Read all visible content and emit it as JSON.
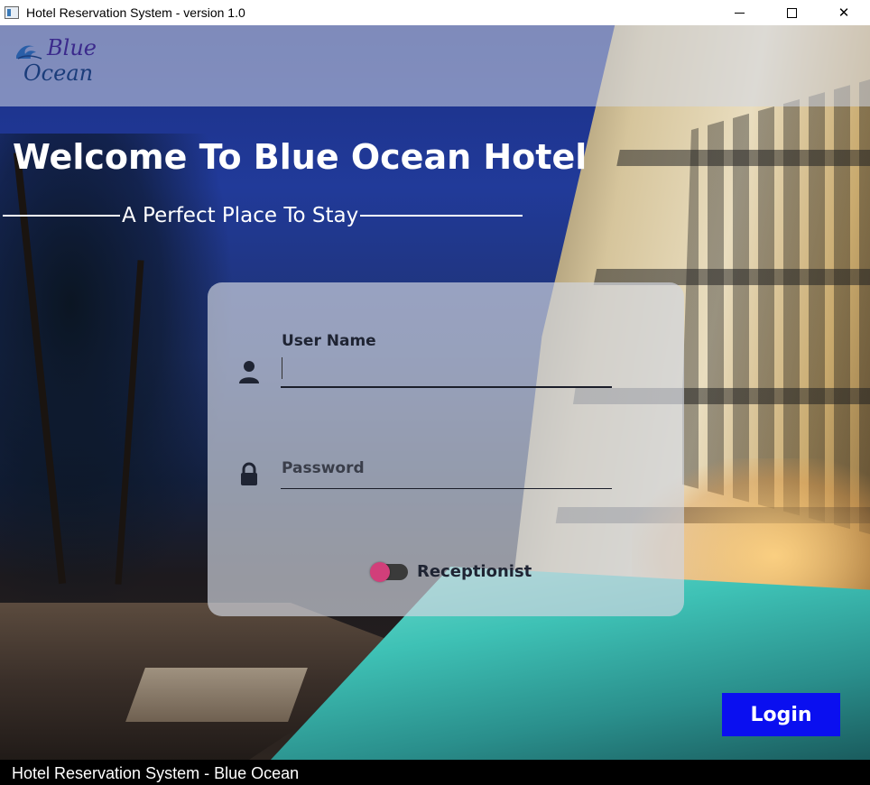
{
  "window": {
    "title": "Hotel Reservation System - version 1.0",
    "controls": [
      "minimize-icon",
      "maximize-icon",
      "close-icon"
    ],
    "close_glyph": "✕"
  },
  "logo": {
    "line1": "Blue",
    "line2": "Ocean"
  },
  "hero": {
    "title": "Welcome To Blue Ocean Hotel",
    "tagline": "A Perfect Place To Stay"
  },
  "login_form": {
    "username_label": "User Name",
    "username_value": "",
    "password_label": "Password",
    "password_value": "",
    "role_toggle_label": "Receptionist",
    "role_toggle_on": false,
    "submit_label": "Login"
  },
  "status_bar": {
    "text": "Hotel Reservation System - Blue Ocean"
  },
  "colors": {
    "login_button": "#0a0ff0",
    "toggle_knob": "#d13f7a",
    "heading_text": "#ffffff",
    "label_text": "#1f2433"
  }
}
